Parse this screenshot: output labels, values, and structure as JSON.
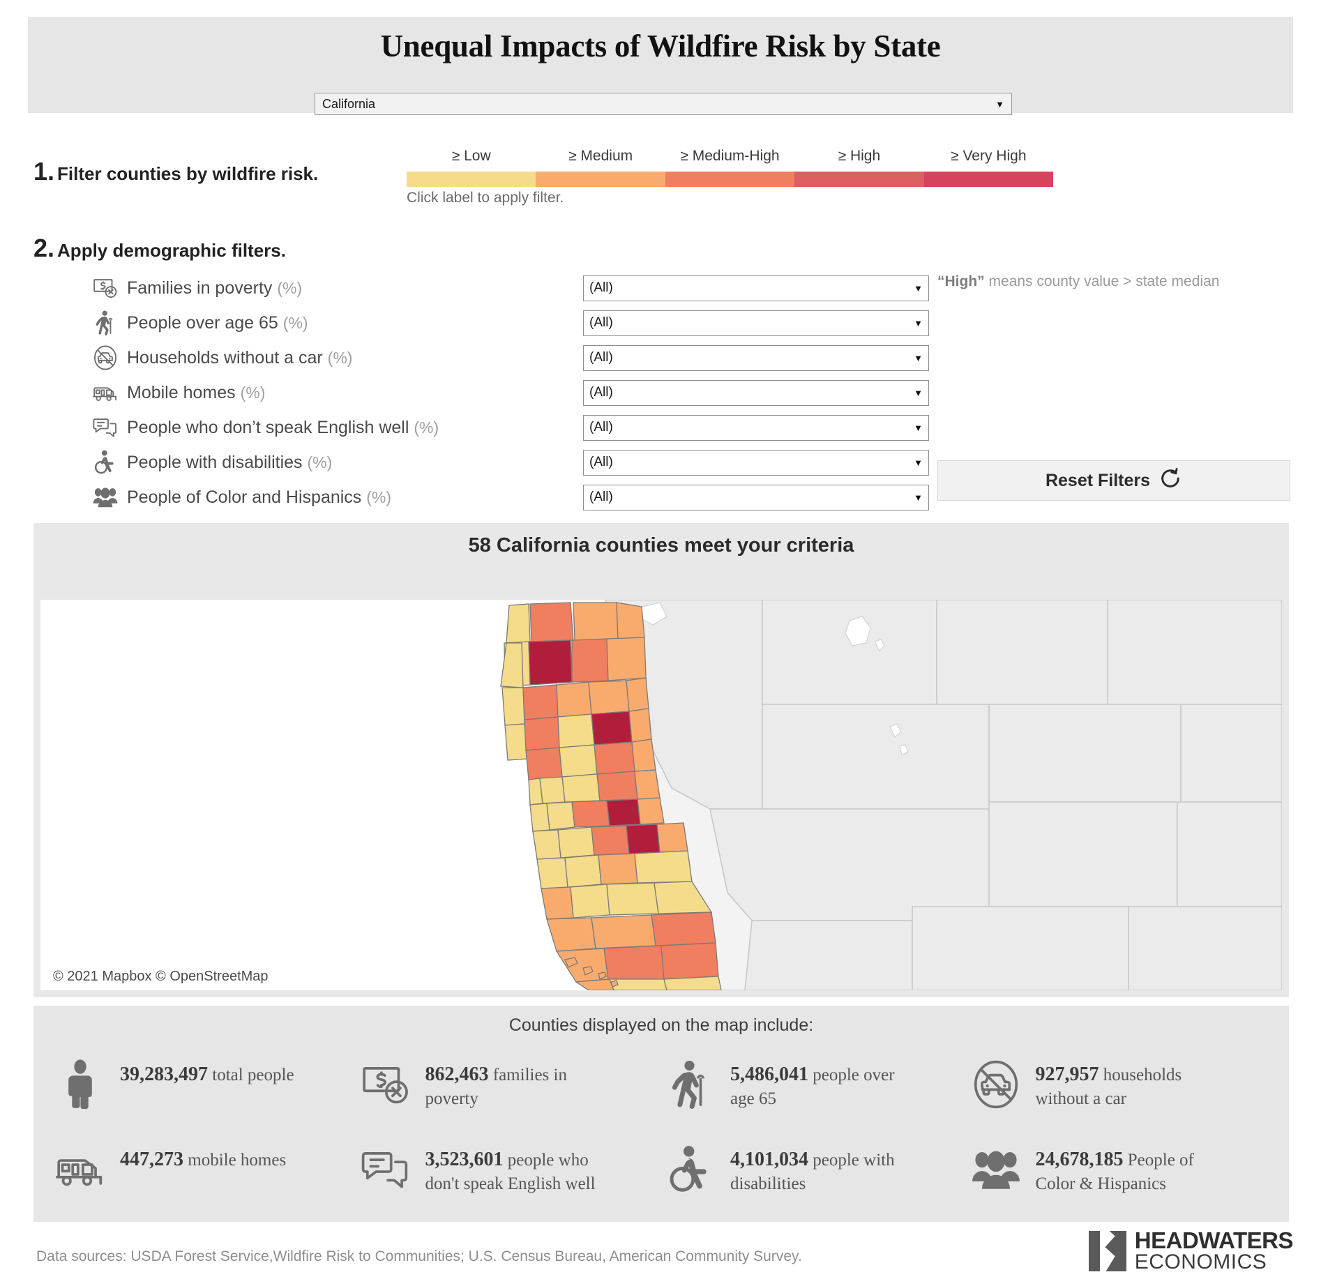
{
  "header": {
    "title": "Unequal Impacts of Wildfire Risk by State",
    "state_selected": "California",
    "caret": "▼"
  },
  "step1": {
    "number": "1.",
    "text": "Filter counties by wildfire risk.",
    "hint": "Click label to apply filter.",
    "legend": [
      {
        "label": "≥ Low",
        "color": "#f5dc8a"
      },
      {
        "label": "≥ Medium",
        "color": "#f9ab6e"
      },
      {
        "label": "≥ Medium-High",
        "color": "#f07f5f"
      },
      {
        "label": "≥ High",
        "color": "#dd5f61"
      },
      {
        "label": "≥ Very High",
        "color": "#d7435f"
      }
    ]
  },
  "step2": {
    "number": "2.",
    "text": "Apply demographic filters.",
    "note": "“High” means county value > state median",
    "note_bold": "“High”",
    "note_rest": " means county value > state median",
    "reset_label": "Reset Filters",
    "reset_icon": "reset-arrow-icon",
    "filters": [
      {
        "icon": "money-poverty-icon",
        "label": "Families in poverty",
        "unit": "(%)",
        "value": "(All)"
      },
      {
        "icon": "elderly-person-icon",
        "label": "People over age 65",
        "unit": "(%)",
        "value": "(All)"
      },
      {
        "icon": "no-car-icon",
        "label": "Households without a car",
        "unit": "(%)",
        "value": "(All)"
      },
      {
        "icon": "mobile-home-icon",
        "label": "Mobile homes",
        "unit": "(%)",
        "value": "(All)"
      },
      {
        "icon": "speech-bubble-icon",
        "label": "People who don’t speak English well",
        "unit": "(%)",
        "value": "(All)"
      },
      {
        "icon": "wheelchair-icon",
        "label": "People with disabilities",
        "unit": "(%)",
        "value": "(All)"
      },
      {
        "icon": "people-group-icon",
        "label": "People of Color and Hispanics",
        "unit": "(%)",
        "value": "(All)"
      }
    ]
  },
  "map": {
    "title": "58 California counties meet your criteria",
    "attribution": "© 2021 Mapbox  © OpenStreetMap"
  },
  "stats": {
    "title": "Counties displayed on the map include:",
    "items": [
      {
        "icon": "person-icon",
        "value": "39,283,497",
        "label": "total people"
      },
      {
        "icon": "money-poverty-icon",
        "value": "862,463",
        "label": "families in poverty"
      },
      {
        "icon": "elderly-person-icon",
        "value": "5,486,041",
        "label": "people over age 65"
      },
      {
        "icon": "no-car-icon",
        "value": "927,957",
        "label": "households without a car"
      },
      {
        "icon": "mobile-home-icon",
        "value": "447,273",
        "label": "mobile homes"
      },
      {
        "icon": "speech-bubble-icon",
        "value": "3,523,601",
        "label": "people who don't speak English well"
      },
      {
        "icon": "wheelchair-icon",
        "value": "4,101,034",
        "label": "people with disabilities"
      },
      {
        "icon": "people-group-icon",
        "value": "24,678,185",
        "label": "People of Color & Hispanics"
      }
    ]
  },
  "footer": {
    "sources": "Data sources: USDA Forest Service,Wildfire Risk to Communities; U.S. Census Bureau, American Community Survey.",
    "logo_line1": "HEADWATERS",
    "logo_line2": "ECONOMICS"
  },
  "colors": {
    "panel_bg": "#e6e6e6",
    "map_bg": "#ffffff",
    "state_fill": "#ebebeb",
    "state_stroke": "#c9c9c9"
  }
}
